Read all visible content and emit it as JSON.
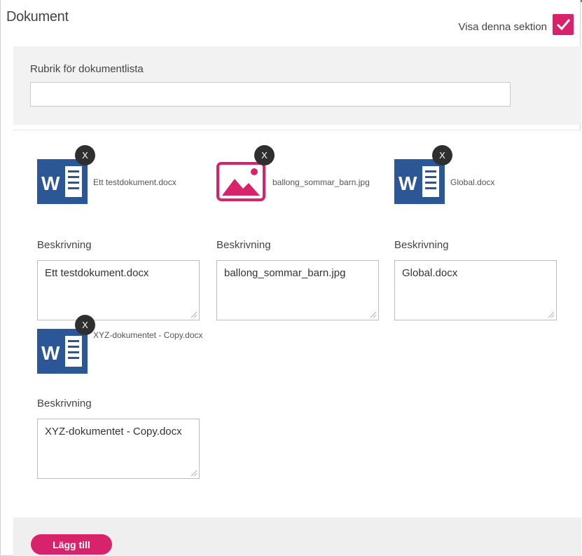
{
  "section": {
    "title": "Dokument",
    "show_label": "Visa denna sektion",
    "show_checked": true
  },
  "list_title": {
    "label": "Rubrik för dokumentlista",
    "value": ""
  },
  "documents": [
    {
      "type": "word",
      "name": "Ett testdokument.docx",
      "remove_label": "X",
      "description_label": "Beskrivning",
      "description": "Ett testdokument.docx"
    },
    {
      "type": "image",
      "name": "ballong_sommar_barn.jpg",
      "remove_label": "X",
      "description_label": "Beskrivning",
      "description": "ballong_sommar_barn.jpg"
    },
    {
      "type": "word",
      "name": "Global.docx",
      "remove_label": "X",
      "description_label": "Beskrivning",
      "description": "Global.docx"
    },
    {
      "type": "word",
      "name": "XYZ-dokumentet - Copy.docx",
      "remove_label": "X",
      "description_label": "Beskrivning",
      "description": "XYZ-dokumentet - Copy.docx"
    }
  ],
  "add_button_label": "Lägg till",
  "colors": {
    "accent": "#d8226c",
    "word_blue": "#2b5797",
    "remove_dark": "#2f2f2f"
  }
}
